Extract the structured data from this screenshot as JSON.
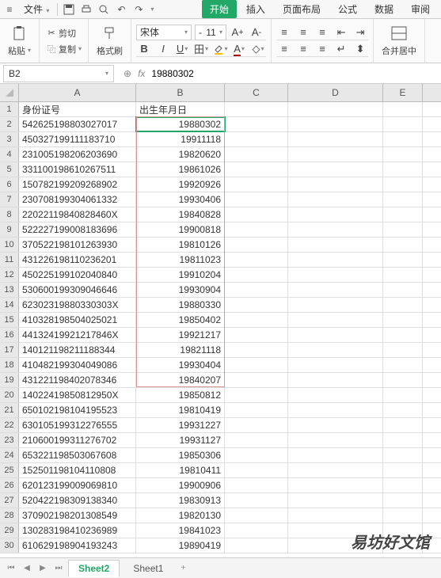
{
  "menu": {
    "file": "文件",
    "dropdown": "▾"
  },
  "ribbon_tabs": [
    "开始",
    "插入",
    "页面布局",
    "公式",
    "数据",
    "审阅"
  ],
  "active_tab": 0,
  "clip": {
    "paste": "粘贴",
    "cut": "剪切",
    "copy": "复制",
    "format": "格式刷"
  },
  "font": {
    "name": "宋体",
    "size": "11"
  },
  "merge": "合并居中",
  "namebox": "B2",
  "formula": "19880302",
  "columns": [
    "A",
    "B",
    "C",
    "D",
    "E"
  ],
  "headers": {
    "A": "身份证号",
    "B": "出生年月日"
  },
  "rows": [
    {
      "n": 1,
      "a": "身份证号",
      "b": "出生年月日",
      "hdr": true
    },
    {
      "n": 2,
      "a": "542625198803027017",
      "b": "19880302",
      "sel": true
    },
    {
      "n": 3,
      "a": "450327199111183710",
      "b": "19911118"
    },
    {
      "n": 4,
      "a": "231005198206203690",
      "b": "19820620"
    },
    {
      "n": 5,
      "a": "331100198610267511",
      "b": "19861026"
    },
    {
      "n": 6,
      "a": "150782199209268902",
      "b": "19920926"
    },
    {
      "n": 7,
      "a": "230708199304061332",
      "b": "19930406"
    },
    {
      "n": 8,
      "a": "22022119840828460X",
      "b": "19840828"
    },
    {
      "n": 9,
      "a": "522227199008183696",
      "b": "19900818"
    },
    {
      "n": 10,
      "a": "370522198101263930",
      "b": "19810126"
    },
    {
      "n": 11,
      "a": "431226198110236201",
      "b": "19811023"
    },
    {
      "n": 12,
      "a": "450225199102040840",
      "b": "19910204"
    },
    {
      "n": 13,
      "a": "530600199309046646",
      "b": "19930904"
    },
    {
      "n": 14,
      "a": "62302319880330303X",
      "b": "19880330"
    },
    {
      "n": 15,
      "a": "410328198504025021",
      "b": "19850402"
    },
    {
      "n": 16,
      "a": "44132419921217846X",
      "b": "19921217"
    },
    {
      "n": 17,
      "a": "140121198211188344",
      "b": "19821118"
    },
    {
      "n": 18,
      "a": "410482199304049086",
      "b": "19930404"
    },
    {
      "n": 19,
      "a": "431221198402078346",
      "b": "19840207"
    },
    {
      "n": 20,
      "a": "14022419850812950X",
      "b": "19850812"
    },
    {
      "n": 21,
      "a": "650102198104195523",
      "b": "19810419"
    },
    {
      "n": 22,
      "a": "630105199312276555",
      "b": "19931227"
    },
    {
      "n": 23,
      "a": "210600199311276702",
      "b": "19931127"
    },
    {
      "n": 24,
      "a": "653221198503067608",
      "b": "19850306"
    },
    {
      "n": 25,
      "a": "152501198104110808",
      "b": "19810411"
    },
    {
      "n": 26,
      "a": "620123199009069810",
      "b": "19900906"
    },
    {
      "n": 27,
      "a": "520422198309138340",
      "b": "19830913"
    },
    {
      "n": 28,
      "a": "370902198201308549",
      "b": "19820130"
    },
    {
      "n": 29,
      "a": "130283198410236989",
      "b": "19841023"
    },
    {
      "n": 30,
      "a": "610629198904193243",
      "b": "19890419"
    }
  ],
  "sheets": {
    "s1": "Sheet2",
    "s2": "Sheet1",
    "add": "+"
  },
  "watermark": "易坊好文馆"
}
